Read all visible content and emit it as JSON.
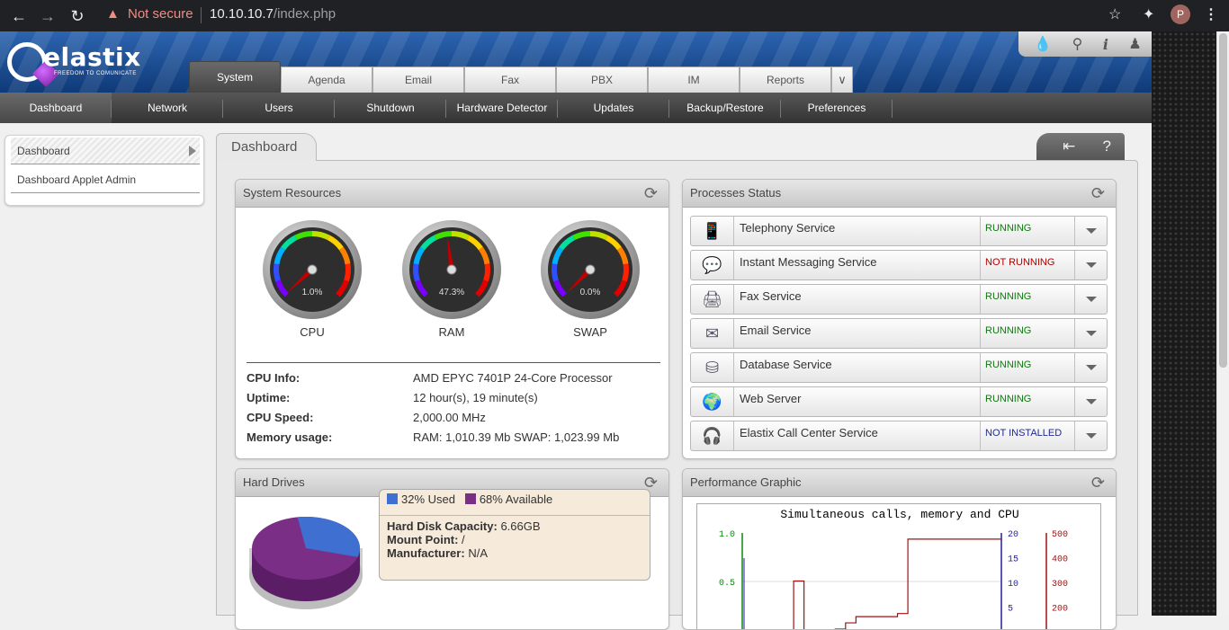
{
  "browser": {
    "security_label": "Not secure",
    "url_host": "10.10.10.7",
    "url_path": "/index.php",
    "profile_initial": "P"
  },
  "header": {
    "logo_text": "elastix",
    "logo_tagline": "FREEDOM TO COMUNICATE",
    "tabs": [
      "System",
      "Agenda",
      "Email",
      "Fax",
      "PBX",
      "IM",
      "Reports"
    ],
    "active_tab": "System"
  },
  "subnav": {
    "items": [
      "Dashboard",
      "Network",
      "Users",
      "Shutdown",
      "Hardware Detector",
      "Updates",
      "Backup/Restore",
      "Preferences"
    ]
  },
  "sidebar": {
    "items": [
      "Dashboard",
      "Dashboard Applet Admin"
    ]
  },
  "main": {
    "tab_title": "Dashboard",
    "collapse_icon": "⇤",
    "help_icon": "?"
  },
  "system_resources": {
    "title": "System Resources",
    "gauges": [
      {
        "label": "CPU",
        "value_text": "1.0%",
        "percent": 1.0
      },
      {
        "label": "RAM",
        "value_text": "47.3%",
        "percent": 47.3
      },
      {
        "label": "SWAP",
        "value_text": "0.0%",
        "percent": 0.0
      }
    ],
    "info": [
      {
        "key": "CPU Info:",
        "value": "AMD EPYC 7401P 24-Core Processor"
      },
      {
        "key": "Uptime:",
        "value": "12 hour(s), 19 minute(s)"
      },
      {
        "key": "CPU Speed:",
        "value": "2,000.00 MHz"
      },
      {
        "key": "Memory usage:",
        "value": "RAM: 1,010.39 Mb SWAP: 1,023.99 Mb"
      }
    ]
  },
  "processes": {
    "title": "Processes Status",
    "items": [
      {
        "name": "Telephony Service",
        "status": "RUNNING",
        "icon": "phone-icon"
      },
      {
        "name": "Instant Messaging Service",
        "status": "NOT RUNNING",
        "icon": "chat-icon"
      },
      {
        "name": "Fax Service",
        "status": "RUNNING",
        "icon": "fax-icon"
      },
      {
        "name": "Email Service",
        "status": "RUNNING",
        "icon": "envelope-icon"
      },
      {
        "name": "Database Service",
        "status": "RUNNING",
        "icon": "database-icon"
      },
      {
        "name": "Web Server",
        "status": "RUNNING",
        "icon": "globe-icon"
      },
      {
        "name": "Elastix Call Center Service",
        "status": "NOT INSTALLED",
        "icon": "headset-icon"
      }
    ]
  },
  "hard_drives": {
    "title": "Hard Drives",
    "used_label": "32% Used",
    "available_label": "68% Available",
    "used_percent": 32,
    "capacity_key": "Hard Disk Capacity:",
    "capacity_value": "6.66GB",
    "mount_key": "Mount Point:",
    "mount_value": "/",
    "manufacturer_key": "Manufacturer:",
    "manufacturer_value": "N/A",
    "colors": {
      "used": "#3f6fd0",
      "available": "#7b2e86"
    }
  },
  "performance": {
    "title": "Performance Graphic",
    "graph_title": "Simultaneous calls, memory and CPU",
    "chart_data": {
      "type": "line",
      "title": "Simultaneous calls, memory and CPU",
      "y_axes": [
        {
          "ticks": [
            "1.0",
            "0.5"
          ],
          "color": "#0a8a0a"
        },
        {
          "ticks": [
            "20",
            "15",
            "10",
            "5"
          ],
          "color": "#1f1f9f"
        },
        {
          "ticks": [
            "500",
            "400",
            "300",
            "200"
          ],
          "color": "#a01010"
        }
      ],
      "series": [
        {
          "values": [
            160,
            160,
            345,
            160,
            160,
            175,
            190,
            210,
            230,
            230,
            230,
            230,
            240,
            480,
            480,
            480,
            480,
            480,
            480,
            480,
            480,
            480,
            480
          ]
        }
      ]
    }
  }
}
